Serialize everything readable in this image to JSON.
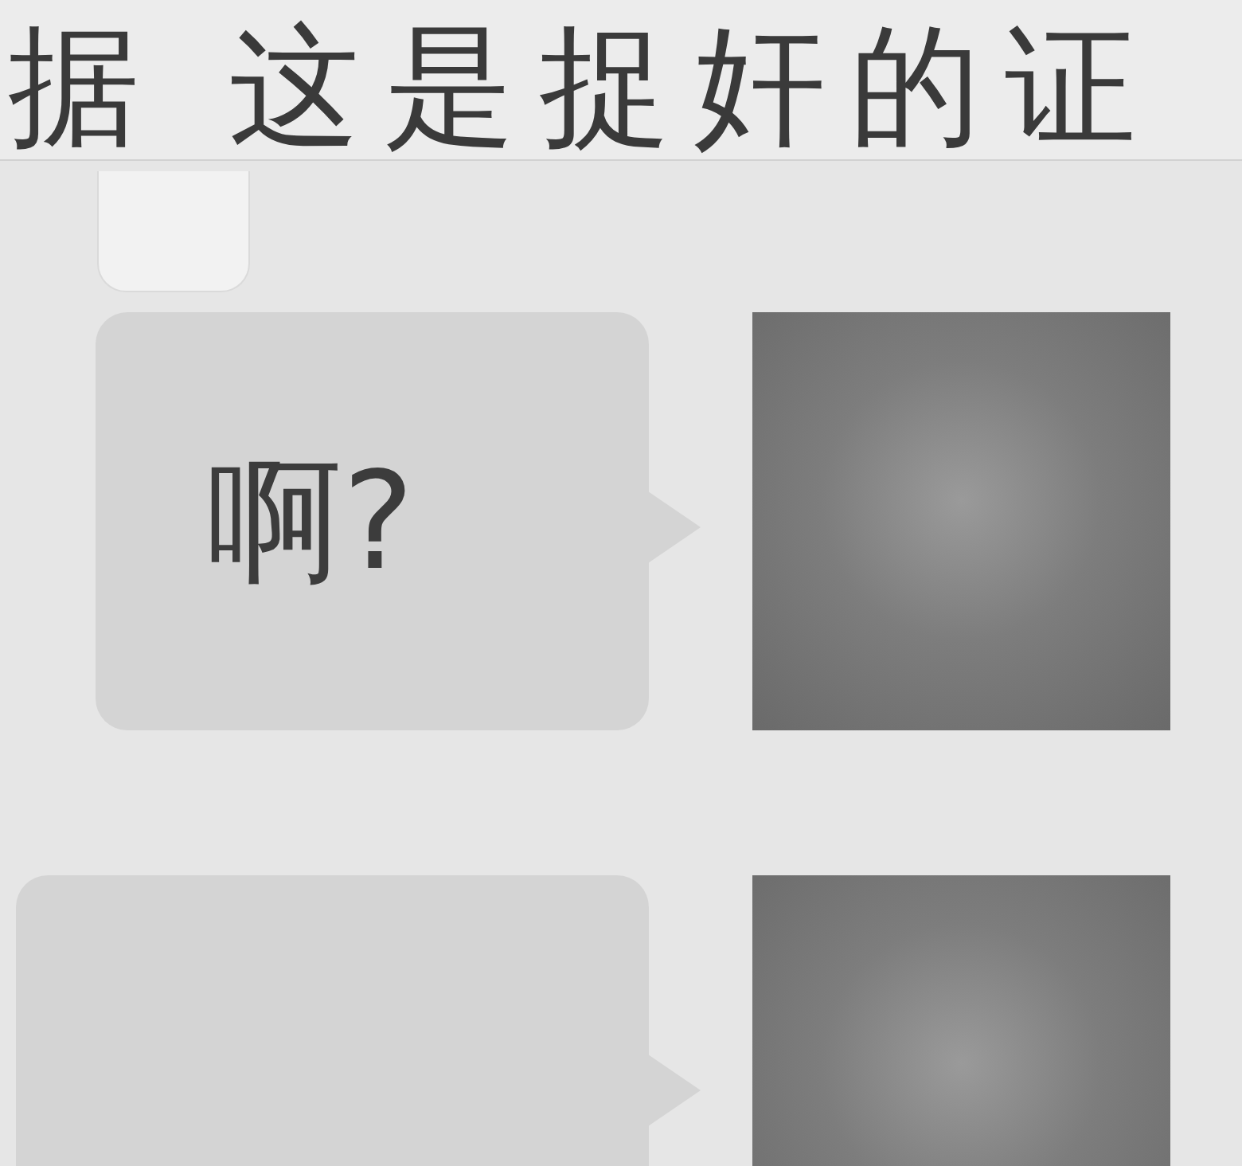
{
  "header": {
    "title": "据 这是捉奸的证"
  },
  "messages": [
    {
      "text": "啊?"
    },
    {}
  ]
}
